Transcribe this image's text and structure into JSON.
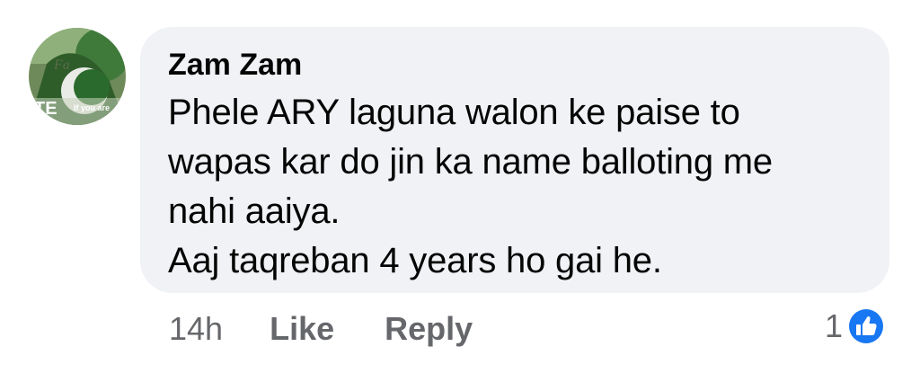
{
  "comment": {
    "author": "Zam Zam",
    "text_lines": [
      "Phele ARY laguna walon ke paise to",
      "wapas kar do jin ka name balloting me",
      "nahi aaiya.",
      "Aaj taqreban 4 years ho gai he."
    ],
    "avatar_text": {
      "top": "Fa",
      "bottom_left": "TE",
      "bottom_right": "If you are"
    },
    "timestamp": "14h",
    "like_label": "Like",
    "reply_label": "Reply",
    "reaction_count": "1",
    "reaction_icon": "like-thumbs-up-icon",
    "colors": {
      "bubble": "#f0f2f5",
      "text": "#050505",
      "secondary": "#65676b",
      "like_blue": "#1877f2"
    }
  }
}
